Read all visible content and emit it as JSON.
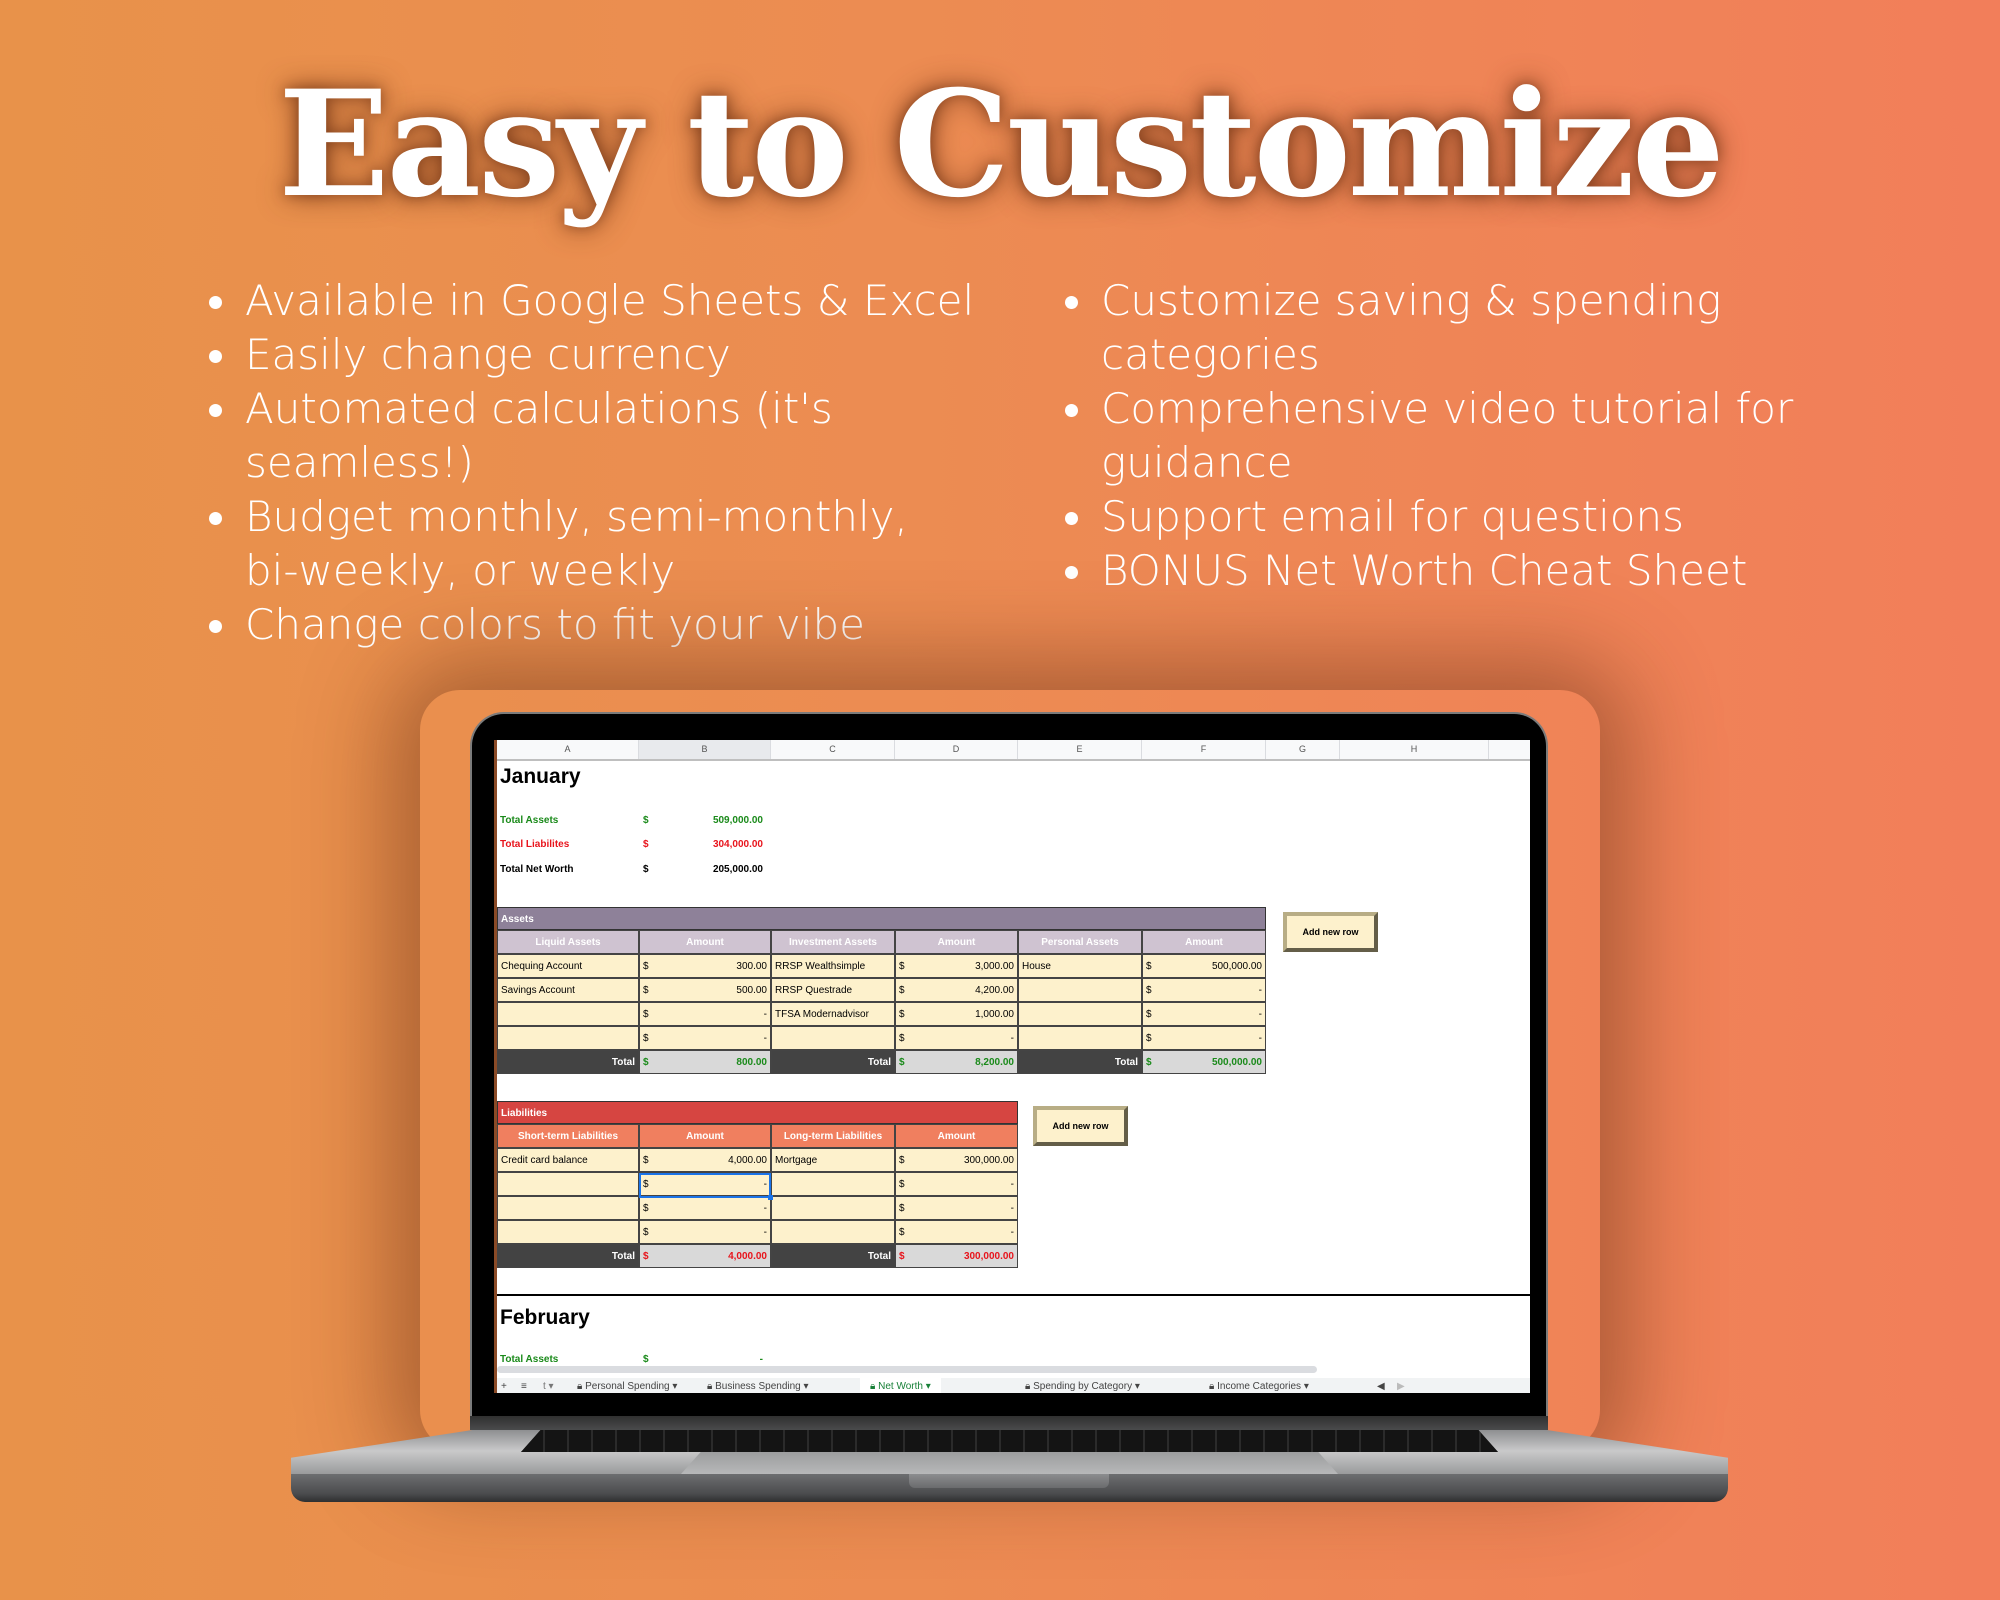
{
  "title": "Easy to Customize",
  "features_left": [
    "Available in Google Sheets & Excel",
    "Easily change currency",
    "Automated calculations (it's seamless!)",
    "Budget monthly, semi-monthly, bi-weekly, or weekly",
    "Change colors to fit your vibe"
  ],
  "features_right": [
    "Customize saving & spending categories",
    "Comprehensive video tutorial for guidance",
    "Support email for questions",
    "BONUS Net Worth Cheat Sheet"
  ],
  "sheet": {
    "columns": [
      "A",
      "B",
      "C",
      "D",
      "E",
      "F",
      "G",
      "H"
    ],
    "selected_column": "B",
    "january": {
      "title": "January",
      "summary": [
        {
          "label": "Total Assets",
          "currency": "$",
          "value": "509,000.00",
          "color": "#1a8a1a"
        },
        {
          "label": "Total Liabilites",
          "currency": "$",
          "value": "304,000.00",
          "color": "#e8141c"
        },
        {
          "label": "Total Net Worth",
          "currency": "$",
          "value": "205,000.00",
          "color": "#000000"
        }
      ],
      "assets": {
        "title": "Assets",
        "bar_color": "#8e8199",
        "header_color": "#cfc3d1",
        "headers": [
          "Liquid Assets",
          "Amount",
          "Investment Assets",
          "Amount",
          "Personal Assets",
          "Amount"
        ],
        "rows": [
          [
            "Chequing Account",
            "300.00",
            "RRSP Wealthsimple",
            "3,000.00",
            "House",
            "500,000.00"
          ],
          [
            "Savings Account",
            "500.00",
            "RRSP Questrade",
            "4,200.00",
            "",
            "-"
          ],
          [
            "",
            "-",
            "TFSA Modernadvisor",
            "1,000.00",
            "",
            "-"
          ],
          [
            "",
            "-",
            "",
            "-",
            "",
            "-"
          ]
        ],
        "total_label": "Total",
        "totals": [
          "800.00",
          "8,200.00",
          "500,000.00"
        ],
        "add_row_label": "Add new row"
      },
      "liabilities": {
        "title": "Liabilities",
        "bar_color": "#d64541",
        "header_color": "#f07f5f",
        "headers": [
          "Short-term Liabilities",
          "Amount",
          "Long-term Liabilities",
          "Amount"
        ],
        "rows": [
          [
            "Credit card balance",
            "4,000.00",
            "Mortgage",
            "300,000.00"
          ],
          [
            "",
            "-",
            "",
            "-"
          ],
          [
            "",
            "-",
            "",
            "-"
          ],
          [
            "",
            "-",
            "",
            "-"
          ]
        ],
        "total_label": "Total",
        "totals": [
          "4,000.00",
          "300,000.00"
        ],
        "add_row_label": "Add new row"
      }
    },
    "february": {
      "title": "February",
      "summary": [
        {
          "label": "Total Assets",
          "currency": "$",
          "value": "-"
        }
      ]
    },
    "currency": "$",
    "tabs": [
      {
        "label": "Personal Spending",
        "active": false
      },
      {
        "label": "Business Spending",
        "active": false
      },
      {
        "label": "Net Worth",
        "active": true
      },
      {
        "label": "Spending by Category",
        "active": false
      },
      {
        "label": "Income Categories",
        "active": false
      }
    ]
  }
}
